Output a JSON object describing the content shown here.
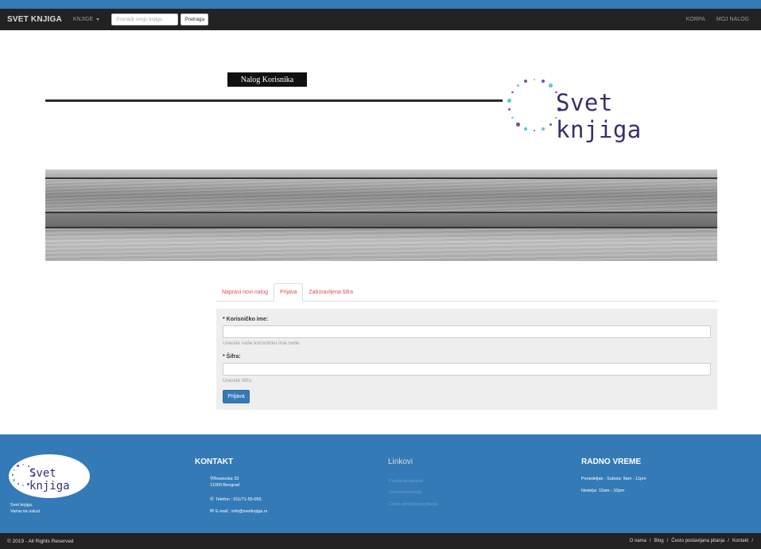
{
  "navbar": {
    "brand": "SVET KNJIGA",
    "books_menu": "KNJIGE",
    "search_placeholder": "Pronađi svoju knjigu",
    "search_button": "Pretraga",
    "cart": "KORPA",
    "account": "MOJ NALOG"
  },
  "header": {
    "page_title": "Nalog Korisnika",
    "logo_text": "Svet knjiga",
    "logo_dot_colors": [
      "#5ec8e3",
      "#6b5aa7"
    ]
  },
  "tabs": [
    {
      "label": "Napravi novi nalog",
      "active": false
    },
    {
      "label": "Prijava",
      "active": true
    },
    {
      "label": "Zaboravljena šifra",
      "active": false
    }
  ],
  "login_form": {
    "username_label": "* Korisničko ime:",
    "username_value": "",
    "username_help": "Unesite vaše korisničko ime ovde.",
    "password_label": "* Šifra:",
    "password_value": "",
    "password_help": "Unesite šifru",
    "submit_label": "Prijava"
  },
  "footer": {
    "logo_text": "Svet knjiga",
    "brand_line1": "Svet knjiga.",
    "brand_line2": "Vama na usluzi",
    "contact_heading": "KONTAKT",
    "address_line1": "Resavska 33",
    "address_line2": "11000 Beograd",
    "phone": "Telefon : 011/71-55-055",
    "email": "E-mail : info@svetknjiga.rs",
    "links_heading": "Linkovi",
    "links": [
      "Pravila privatnosti",
      "Uslovi korišćenja",
      "Često postavljana pitanja"
    ],
    "hours_heading": "RADNO VREME",
    "hours": [
      "Ponedeljak - Subota: 9am - 11pm",
      "Nedelja: 10am - 10pm"
    ]
  },
  "bottom_bar": {
    "copyright": "© 2019 - All Rights Reserved",
    "links": [
      "O nama",
      "Blog",
      "Često postavljana pitanja",
      "Kontakt"
    ],
    "separator": "/"
  },
  "colors": {
    "brand_blue": "#337ab7",
    "navbar_dark": "#222222",
    "tab_red": "#d9534f",
    "logo_purple": "#3a2f6b"
  }
}
